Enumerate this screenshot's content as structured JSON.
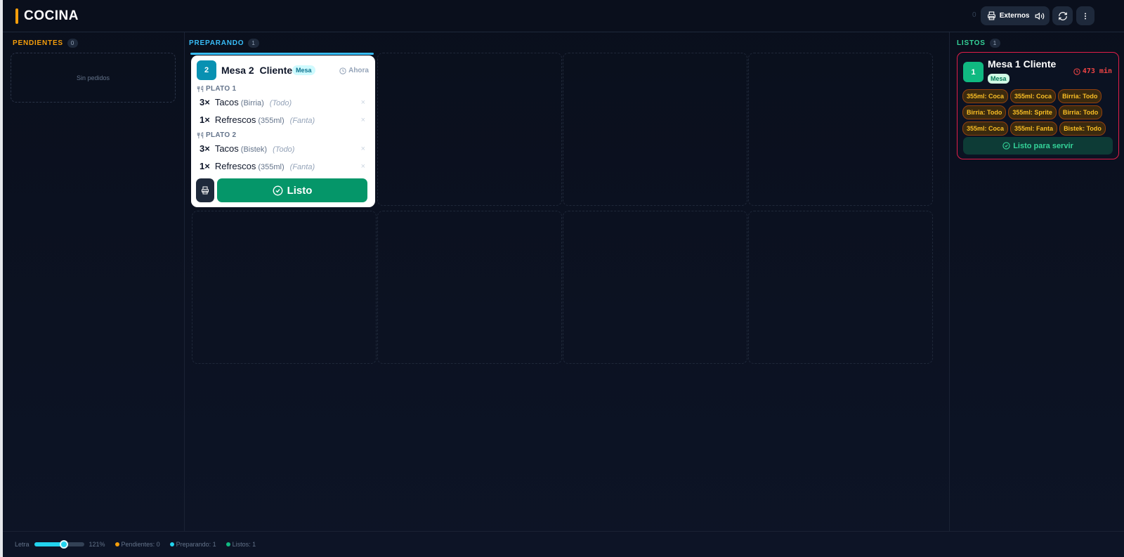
{
  "app": {
    "title": "COCINA",
    "top_counter": "0"
  },
  "toolbar": {
    "externos_label": "Externos ON",
    "icons": [
      "printer-icon",
      "volume-icon",
      "refresh-icon",
      "more-vertical-icon"
    ]
  },
  "columns": {
    "pendientes": {
      "title": "PENDIENTES",
      "count": "0",
      "empty_text": "Sin pedidos",
      "color": "#f59e0b"
    },
    "preparando": {
      "title": "PREPARANDO",
      "count": "1",
      "color": "#38bdf8"
    },
    "listos": {
      "title": "LISTOS",
      "count": "1",
      "color": "#34d399"
    }
  },
  "preparing_order": {
    "number": "2",
    "name": "Mesa 2  Cliente",
    "type": "Mesa",
    "time": "Ahora",
    "platos": [
      {
        "label": "PLATO 1",
        "items": [
          {
            "qty": "3×",
            "name": "Tacos",
            "option": "(Birria)",
            "note": "(Todo)"
          },
          {
            "qty": "1×",
            "name": "Refrescos",
            "option": "(355ml)",
            "note": "(Fanta)"
          }
        ]
      },
      {
        "label": "PLATO 2",
        "items": [
          {
            "qty": "3×",
            "name": "Tacos",
            "option": "(Bistek)",
            "note": "(Todo)"
          },
          {
            "qty": "1×",
            "name": "Refrescos",
            "option": "(355ml)",
            "note": "(Fanta)"
          }
        ]
      }
    ],
    "remove_symbol": "×",
    "listo_label": "Listo"
  },
  "ready_order": {
    "number": "1",
    "name": "Mesa 1 Cliente",
    "type": "Mesa",
    "time": "473 min",
    "chips": [
      "355ml: Coca",
      "355ml: Coca",
      "Birria: Todo",
      "Birria: Todo",
      "355ml: Sprite",
      "Birria: Todo",
      "355ml: Coca",
      "355ml: Fanta",
      "Bistek: Todo"
    ],
    "serve_label": "Listo para servir"
  },
  "footer": {
    "font_label": "Letra",
    "font_value": "121%",
    "font_slider_fraction": 0.6,
    "stats": [
      {
        "label": "Pendientes: 0",
        "color": "#f59e0b"
      },
      {
        "label": "Preparando: 1",
        "color": "#22d3ee"
      },
      {
        "label": "Listos: 1",
        "color": "#10b981"
      }
    ]
  }
}
